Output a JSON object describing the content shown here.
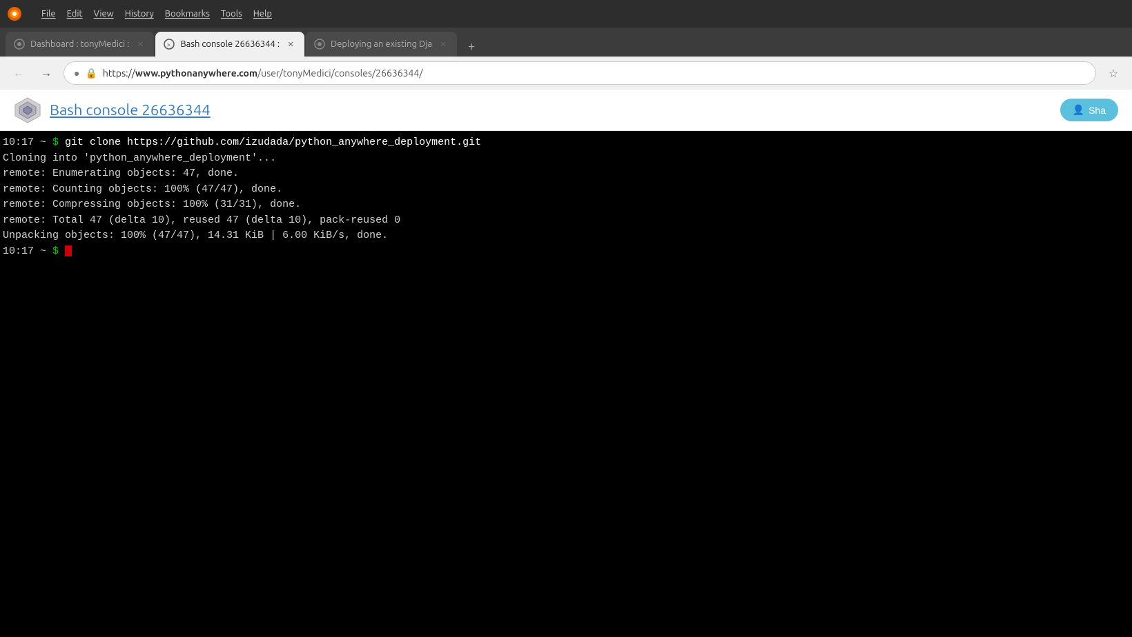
{
  "titlebar": {
    "menu_items": [
      "File",
      "Edit",
      "View",
      "History",
      "Bookmarks",
      "Tools",
      "Help"
    ]
  },
  "tabs": [
    {
      "id": "tab-dashboard",
      "label": "Dashboard : tonyMedici :",
      "active": false,
      "icon": "page-icon"
    },
    {
      "id": "tab-bash",
      "label": "Bash console 26636344 :",
      "active": true,
      "icon": "console-icon"
    },
    {
      "id": "tab-deploying",
      "label": "Deploying an existing Dja",
      "active": false,
      "icon": "page-icon"
    }
  ],
  "addressbar": {
    "back_title": "Back",
    "forward_title": "Forward",
    "url_display": "https://www.pythonanywhere.com/user/tonyMedici/consoles/26636344/",
    "url_prefix": "https://",
    "url_domain": "www.pythonanywhere.com",
    "url_path": "/user/tonyMedici/consoles/26636344/"
  },
  "page_header": {
    "title": "Bash console 26636344",
    "share_label": "Sha"
  },
  "terminal": {
    "lines": [
      {
        "type": "command",
        "time": "10:17",
        "dir": "~",
        "cmd": "git clone https://github.com/izudada/python_anywhere_deployment.git"
      },
      {
        "type": "output",
        "text": "Cloning into 'python_anywhere_deployment'..."
      },
      {
        "type": "output",
        "text": "remote: Enumerating objects: 47, done."
      },
      {
        "type": "output",
        "text": "remote: Counting objects: 100% (47/47), done."
      },
      {
        "type": "output",
        "text": "remote: Compressing objects: 100% (31/31), done."
      },
      {
        "type": "output",
        "text": "remote: Total 47 (delta 10), reused 47 (delta 10), pack-reused 0"
      },
      {
        "type": "output",
        "text": "Unpacking objects: 100% (47/47), 14.31 KiB | 6.00 KiB/s, done."
      },
      {
        "type": "prompt",
        "time": "10:17",
        "dir": "~"
      }
    ]
  }
}
